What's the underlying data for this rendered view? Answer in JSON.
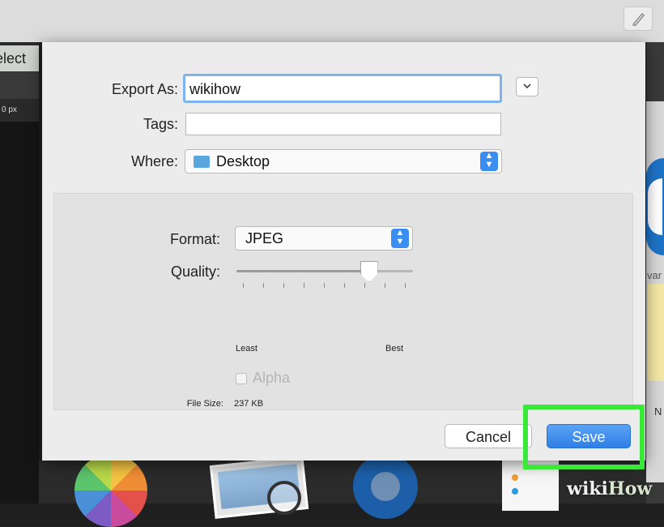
{
  "background": {
    "select_tab_label": "elect",
    "px_label": "0 px",
    "right_partial_label": "var",
    "right_partial_letter": "N"
  },
  "export_sheet": {
    "export_as_label": "Export As:",
    "export_as_value": "wikihow",
    "tags_label": "Tags:",
    "tags_value": "",
    "where_label": "Where:",
    "where_value": "Desktop",
    "format_label": "Format:",
    "format_value": "JPEG",
    "quality_label": "Quality:",
    "quality_value": 0.75,
    "quality_min_label": "Least",
    "quality_max_label": "Best",
    "alpha_label": "Alpha",
    "alpha_checked": false,
    "file_size_label": "File Size:",
    "file_size_value": "237 KB",
    "cancel_label": "Cancel",
    "save_label": "Save"
  },
  "watermark": {
    "part1": "wiki",
    "part2": "How"
  },
  "colors": {
    "accent_blue": "#3a8ef1",
    "highlight_green": "#3ae83a",
    "folder_blue": "#5aa7e0"
  },
  "icons": {
    "pencil": "pencil-icon",
    "folder": "folder-icon",
    "chevron_down": "chevron-down-icon",
    "updown": "updown-chevron-icon"
  }
}
